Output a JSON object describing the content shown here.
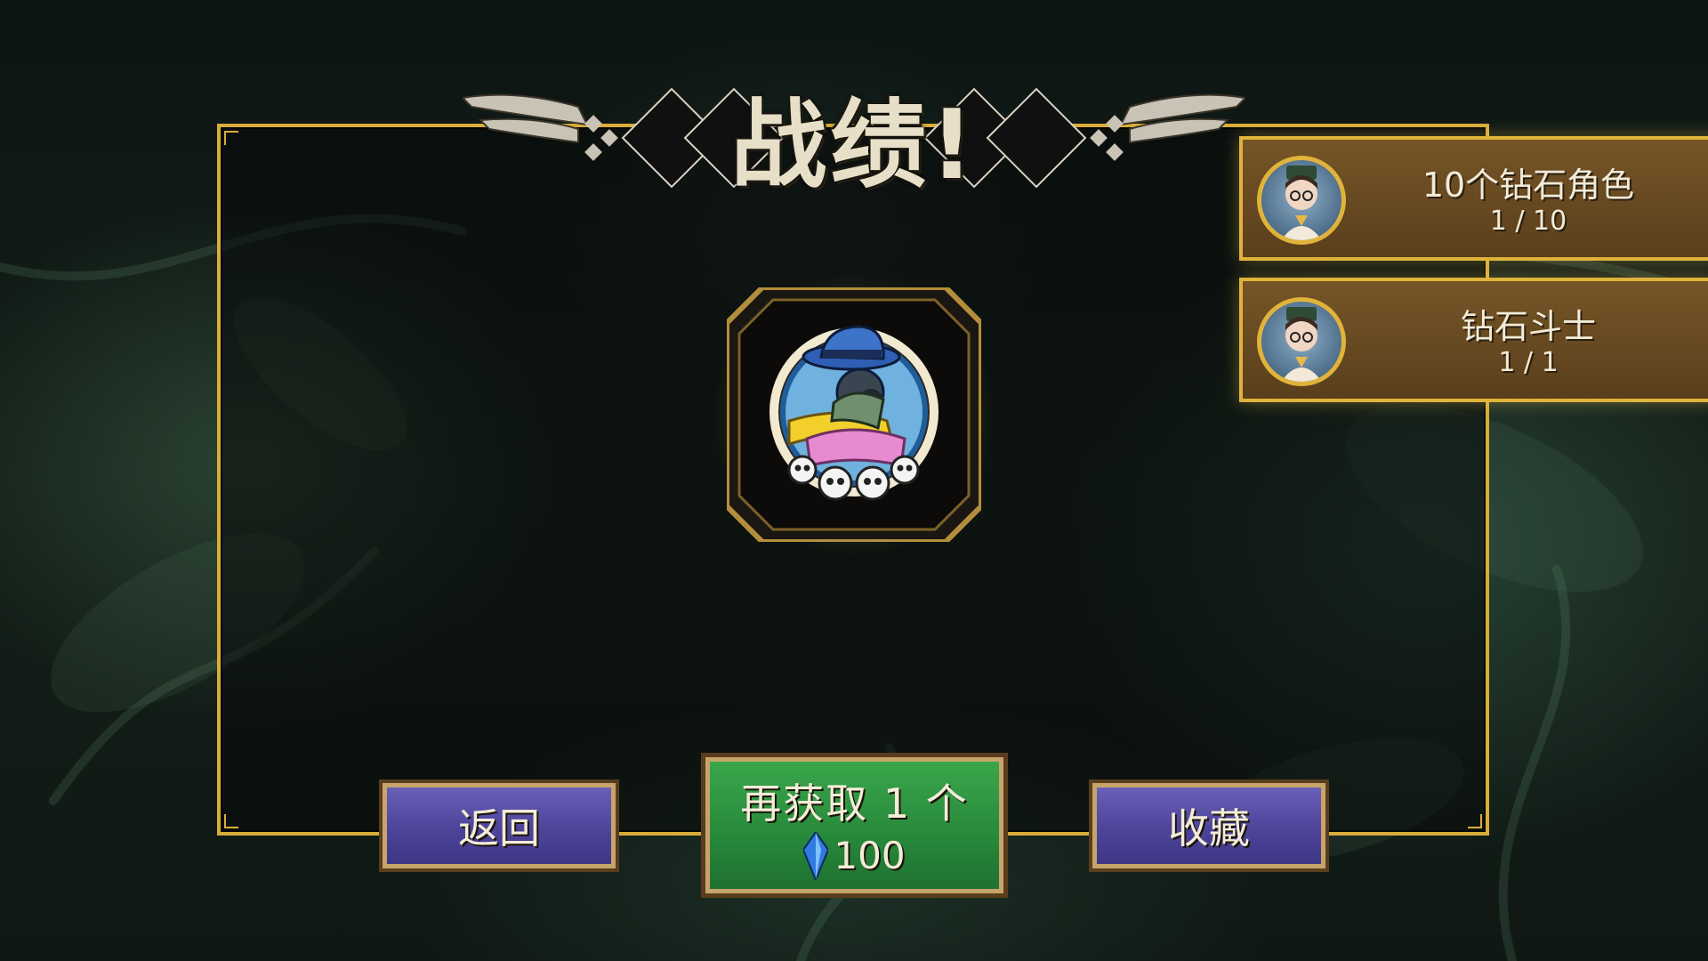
{
  "screen": {
    "title": "战绩!"
  },
  "achievements": [
    {
      "title": "10个钻石角色",
      "progress": "1 / 10"
    },
    {
      "title": "钻石斗士",
      "progress": "1 / 1"
    }
  ],
  "buttons": {
    "back_label": "返回",
    "get_more_label": "再获取 1 个",
    "get_more_cost": "100",
    "collection_label": "收藏"
  },
  "colors": {
    "gold_border": "#d9ad3c",
    "purple_button": "#4d449a",
    "green_button": "#27883a",
    "card_brown": "#6a4b22"
  },
  "icons": {
    "badge": "gasmask-character-badge-icon",
    "currency": "blue-crystal-icon",
    "avatar": "character-portrait-icon"
  }
}
